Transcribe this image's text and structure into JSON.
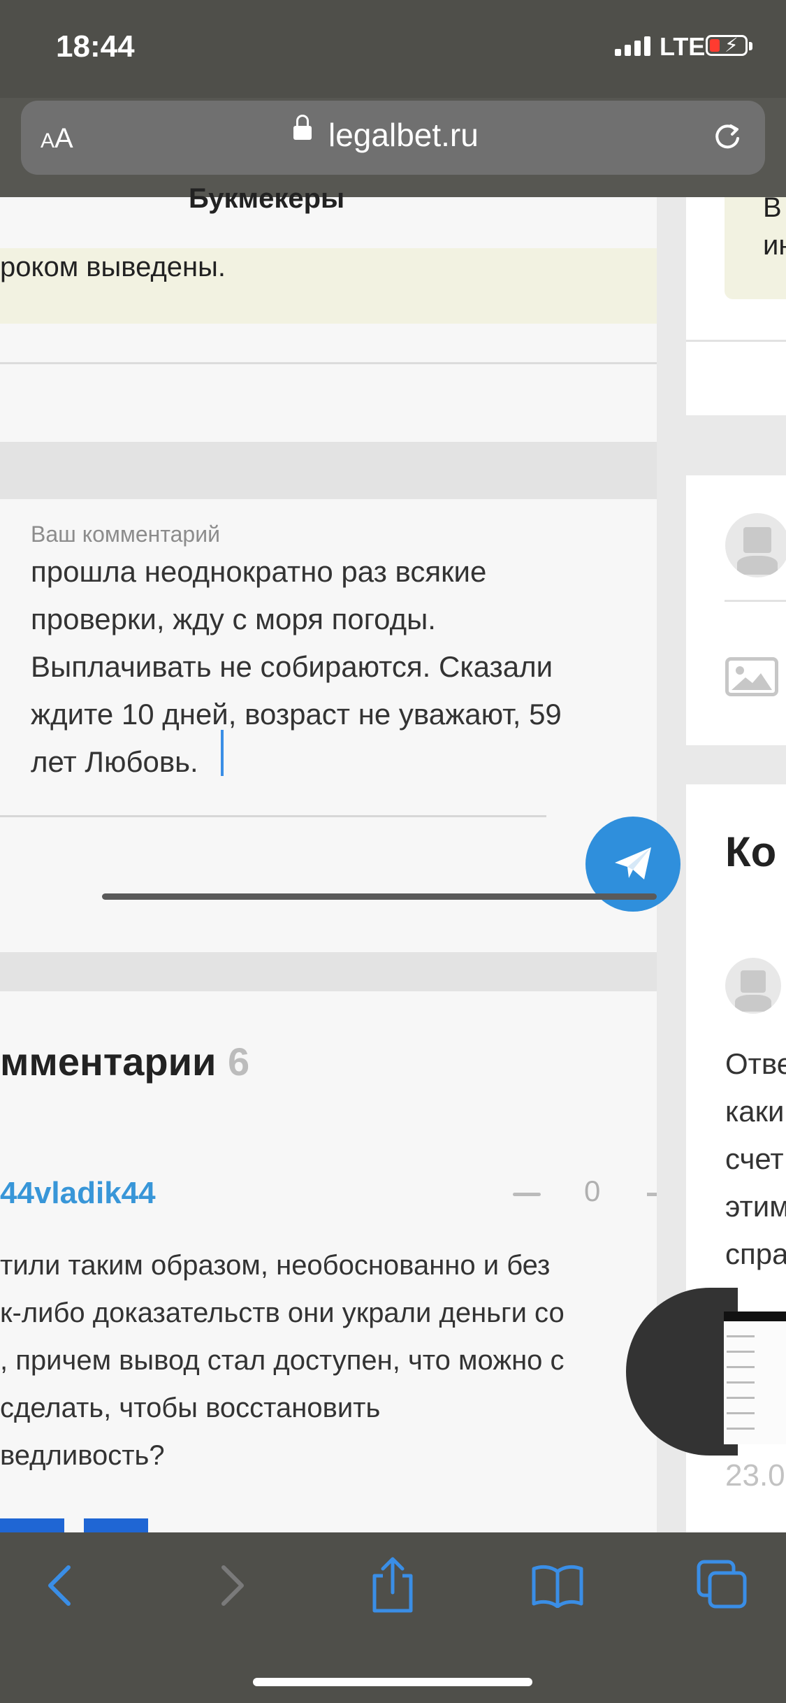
{
  "status": {
    "time": "18:44",
    "network": "LTE"
  },
  "browser": {
    "text_size_label": "AA",
    "domain": "legalbet.ru"
  },
  "main": {
    "nav_title": "Букмекеры",
    "notice_text": "роком выведены.",
    "comment_form": {
      "label": "Ваш комментарий",
      "lines": [
        "прошла неоднократно раз всякие",
        "проверки, жду с моря погоды.",
        "Выплачивать не собираются. Сказали",
        "ждите 10 дней, возраст не уважают,  59",
        "лет Любовь."
      ]
    },
    "comments": {
      "heading": "мментарии",
      "count": "6",
      "first": {
        "author": "44vladik44",
        "votes": "0",
        "lines": [
          "тили таким образом, необоснованно и без",
          "к-либо доказательств они украли деньги со",
          ", причем вывод стал доступен, что можно с",
          "сделать, чтобы восстановить",
          "ведливость?"
        ]
      }
    }
  },
  "right": {
    "banner_lines": [
      "В",
      "ин"
    ],
    "heading": "Ко",
    "comment_lines": [
      "Отве",
      "каки",
      "счет",
      "этим",
      "спра"
    ],
    "date": "23.0"
  },
  "colors": {
    "accent": "#2f8fdc",
    "link": "#3896d8",
    "notice_bg": "#f2f2e1",
    "chrome": "#4f4f4a",
    "toolbar_icon": "#3a8ee6"
  },
  "icons": {
    "toolbar": [
      "back-icon",
      "forward-icon",
      "share-icon",
      "bookmarks-icon",
      "tabs-icon"
    ]
  }
}
